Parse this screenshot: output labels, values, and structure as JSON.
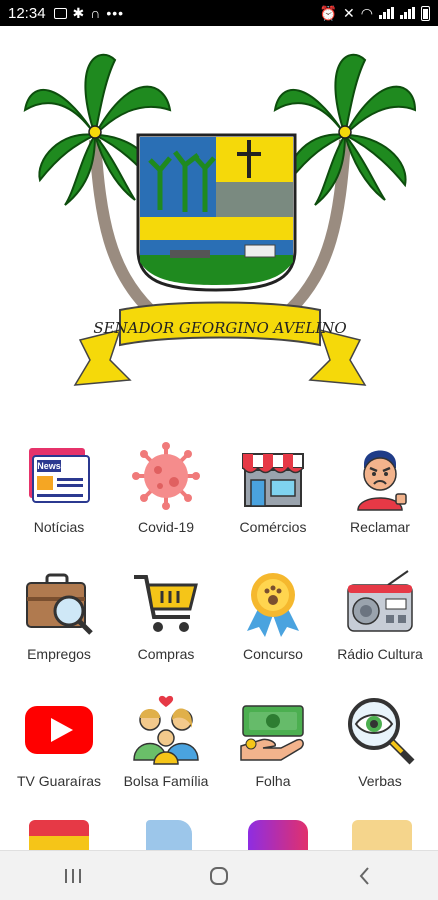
{
  "status_bar": {
    "time": "12:34",
    "dots": "•••"
  },
  "emblem": {
    "banner_text": "SENADOR GEORGINO AVELINO"
  },
  "menu": [
    {
      "label": "Notícias",
      "icon": "news-icon"
    },
    {
      "label": "Covid-19",
      "icon": "virus-icon"
    },
    {
      "label": "Comércios",
      "icon": "store-icon"
    },
    {
      "label": "Reclamar",
      "icon": "angry-man-icon"
    },
    {
      "label": "Empregos",
      "icon": "briefcase-search-icon"
    },
    {
      "label": "Compras",
      "icon": "shopping-cart-icon"
    },
    {
      "label": "Concurso",
      "icon": "medal-icon"
    },
    {
      "label": "Rádio Cultura",
      "icon": "radio-icon"
    },
    {
      "label": "TV Guaraíras",
      "icon": "youtube-play-icon"
    },
    {
      "label": "Bolsa Família",
      "icon": "family-icon"
    },
    {
      "label": "Folha",
      "icon": "money-hand-icon"
    },
    {
      "label": "Verbas",
      "icon": "magnifier-eye-icon"
    }
  ],
  "colors": {
    "palm_green": "#1f8a1f",
    "banner_yellow": "#f5d90a",
    "status_bar": "#000000",
    "navbar": "#f2f2f2"
  }
}
